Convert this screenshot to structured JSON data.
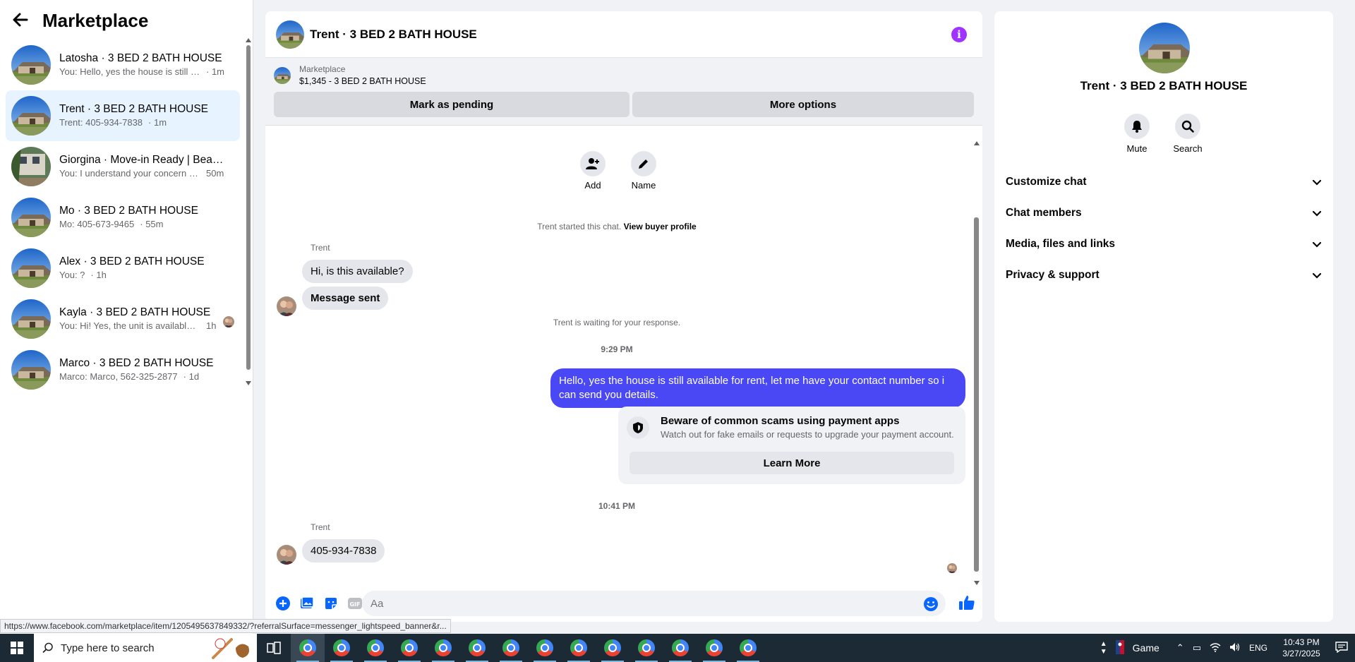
{
  "sidebar": {
    "title": "Marketplace",
    "conversations": [
      {
        "name": "Latosha · 3 BED 2 BATH HOUSE",
        "preview": "You: Hello, yes the house is still av...",
        "time": "· 1m"
      },
      {
        "name": "Trent · 3 BED 2 BATH HOUSE",
        "preview": "Trent: 405-934-7838",
        "time": "· 1m"
      },
      {
        "name": "Giorgina · Move-in Ready | Beau...",
        "preview": "You: I understand your concern a...",
        "time": "50m"
      },
      {
        "name": "Mo · 3 BED 2 BATH HOUSE",
        "preview": "Mo: 405-673-9465",
        "time": "· 55m"
      },
      {
        "name": "Alex · 3 BED 2 BATH HOUSE",
        "preview": "You: ?",
        "time": "· 1h"
      },
      {
        "name": "Kayla · 3 BED 2 BATH HOUSE",
        "preview": "You: Hi! Yes, the unit is available ...",
        "time": "1h"
      },
      {
        "name": "Marco · 3 BED 2 BATH HOUSE",
        "preview": "Marco: Marco, 562-325-2877",
        "time": "· 1d"
      }
    ]
  },
  "chat": {
    "title": "Trent · 3 BED 2 BATH HOUSE",
    "listing": {
      "source": "Marketplace",
      "price_title": "$1,345 - 3 BED 2 BATH HOUSE",
      "btn_pending": "Mark as pending",
      "btn_more": "More options"
    },
    "actions": {
      "add": "Add",
      "name": "Name"
    },
    "started_text": "Trent started this chat.",
    "view_profile": "View buyer profile",
    "sender": "Trent",
    "msg1": "Hi, is this available?",
    "msg2": "Message sent",
    "waiting": "Trent is waiting for your response.",
    "time1": "9:29 PM",
    "outgoing": "Hello, yes the house is still available for rent, let me have your contact number so i can send you details.",
    "scam_title": "Beware of common scams using payment apps",
    "scam_sub": "Watch out for fake emails or requests to upgrade your payment account.",
    "learn_more": "Learn More",
    "time2": "10:41 PM",
    "sender2": "Trent",
    "msg3": "405-934-7838",
    "composer_placeholder": "Aa"
  },
  "right_panel": {
    "title": "Trent · 3 BED 2 BATH HOUSE",
    "mute": "Mute",
    "search": "Search",
    "sections": [
      "Customize chat",
      "Chat members",
      "Media, files and links",
      "Privacy & support"
    ]
  },
  "status_url": "https://www.facebook.com/marketplace/item/1205495637849332/?referralSurface=messenger_lightspeed_banner&r...",
  "taskbar": {
    "search_placeholder": "Type here to search",
    "game_label": "Game",
    "lang": "ENG",
    "time": "10:43 PM",
    "date": "3/27/2025"
  },
  "colors": {
    "accent": "#0866ff",
    "outgoing_bubble": "#4a47f5",
    "active_row": "#e7f3ff",
    "info": "#a033ff"
  }
}
